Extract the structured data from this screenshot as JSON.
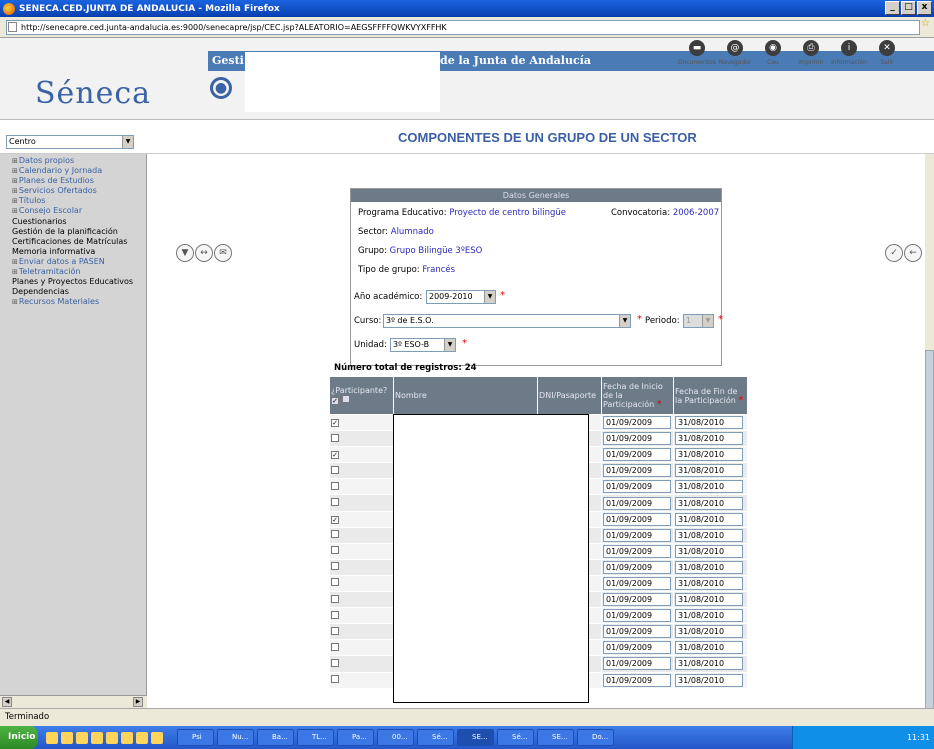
{
  "window": {
    "title": "SENECA.CED.JUNTA DE ANDALUCIA - Mozilla Firefox",
    "url": "http://senecapre.ced.junta-andalucia.es:9000/senecapre/jsp/CEC.jsp?ALEATORIO=AEGSFFFFQWKVYXFFHK",
    "status": "Terminado"
  },
  "header": {
    "logo": "Séneca",
    "banner_left": "Gesti",
    "banner_right": "de la Junta de Andalucía",
    "tools": [
      {
        "label": "Documentos",
        "icon": "documents-icon"
      },
      {
        "label": "Navegador",
        "icon": "browser-icon"
      },
      {
        "label": "Cau",
        "icon": "cau-icon"
      },
      {
        "label": "Imprimir",
        "icon": "print-icon"
      },
      {
        "label": "Información",
        "icon": "info-icon"
      },
      {
        "label": "Salir",
        "icon": "exit-icon"
      }
    ]
  },
  "nav": {
    "centro_select": "Centro",
    "page_title": "COMPONENTES DE UN GRUPO DE UN SECTOR"
  },
  "sidebar": [
    {
      "label": "Datos propios",
      "expandable": true
    },
    {
      "label": "Calendario y Jornada",
      "expandable": true
    },
    {
      "label": "Planes de Estudios",
      "expandable": true
    },
    {
      "label": "Servicios Ofertados",
      "expandable": true
    },
    {
      "label": "Títulos",
      "expandable": true
    },
    {
      "label": "Consejo Escolar",
      "expandable": true
    },
    {
      "label": "Cuestionarios",
      "expandable": false
    },
    {
      "label": "Gestión de la planificación",
      "expandable": false
    },
    {
      "label": "Certificaciones de Matrículas",
      "expandable": false
    },
    {
      "label": "Memoria informativa",
      "expandable": false
    },
    {
      "label": "Enviar datos a PASEN",
      "expandable": true
    },
    {
      "label": "Teletramitación",
      "expandable": true
    },
    {
      "label": "Planes y Proyectos Educativos",
      "expandable": false
    },
    {
      "label": "Dependencias",
      "expandable": false
    },
    {
      "label": "Recursos Materiales",
      "expandable": true
    }
  ],
  "datos": {
    "header": "Datos Generales",
    "programa_label": "Programa Educativo:",
    "programa": "Proyecto de centro bilingüe",
    "convocatoria_label": "Convocatoria:",
    "convocatoria": "2006-2007",
    "sector_label": "Sector:",
    "sector": "Alumnado",
    "grupo_label": "Grupo:",
    "grupo": "Grupo Bilingüe 3ºESO",
    "tipo_label": "Tipo de grupo:",
    "tipo": "Francés"
  },
  "form": {
    "anio_label": "Año académico:",
    "anio": "2009-2010",
    "curso_label": "Curso:",
    "curso": "3º de E.S.O.",
    "periodo_label": "Periodo:",
    "periodo": "1",
    "unidad_label": "Unidad:",
    "unidad": "3º ESO-B"
  },
  "table": {
    "total": "Número total de registros: 24",
    "col_participante": "¿Participante?",
    "col_nombre": "Nombre",
    "col_dni": "DNI/Pasaporte",
    "col_inicio": "Fecha de Inicio de la Participación",
    "col_fin": "Fecha de Fin de la Participación",
    "rows": [
      {
        "checked": true,
        "inicio": "01/09/2009",
        "fin": "31/08/2010"
      },
      {
        "checked": false,
        "inicio": "01/09/2009",
        "fin": "31/08/2010"
      },
      {
        "checked": true,
        "inicio": "01/09/2009",
        "fin": "31/08/2010"
      },
      {
        "checked": false,
        "inicio": "01/09/2009",
        "fin": "31/08/2010"
      },
      {
        "checked": false,
        "inicio": "01/09/2009",
        "fin": "31/08/2010"
      },
      {
        "checked": false,
        "inicio": "01/09/2009",
        "fin": "31/08/2010"
      },
      {
        "checked": true,
        "inicio": "01/09/2009",
        "fin": "31/08/2010"
      },
      {
        "checked": false,
        "inicio": "01/09/2009",
        "fin": "31/08/2010"
      },
      {
        "checked": false,
        "inicio": "01/09/2009",
        "fin": "31/08/2010"
      },
      {
        "checked": false,
        "inicio": "01/09/2009",
        "fin": "31/08/2010"
      },
      {
        "checked": false,
        "inicio": "01/09/2009",
        "fin": "31/08/2010"
      },
      {
        "checked": false,
        "inicio": "01/09/2009",
        "fin": "31/08/2010"
      },
      {
        "checked": false,
        "inicio": "01/09/2009",
        "fin": "31/08/2010"
      },
      {
        "checked": false,
        "inicio": "01/09/2009",
        "fin": "31/08/2010"
      },
      {
        "checked": false,
        "inicio": "01/09/2009",
        "fin": "31/08/2010"
      },
      {
        "checked": false,
        "inicio": "01/09/2009",
        "fin": "31/08/2010"
      },
      {
        "checked": false,
        "inicio": "01/09/2009",
        "fin": "31/08/2010"
      }
    ]
  },
  "taskbar": {
    "start": "Inicio",
    "clock": "11:31",
    "tasks": [
      "Psi",
      "Nu...",
      "Ba...",
      "TL...",
      "Pa...",
      "00...",
      "Sé...",
      "SE...",
      "Sé...",
      "SE...",
      "Do..."
    ]
  }
}
